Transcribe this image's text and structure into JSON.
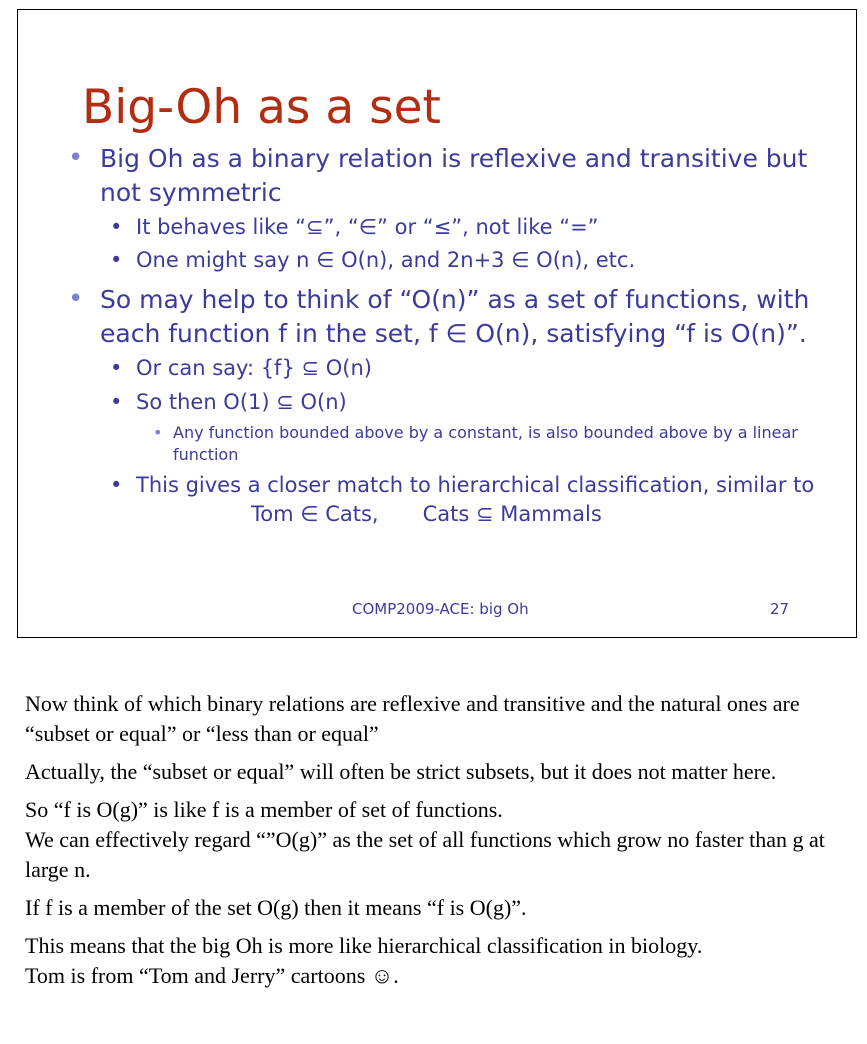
{
  "slide": {
    "title": "Big-Oh as a set",
    "bullets": [
      {
        "level": 1,
        "text": "Big Oh as a binary relation is reflexive and transitive but not symmetric"
      },
      {
        "level": 2,
        "text": "It behaves like “⊆”, “∈” or “≤”, not like “=”"
      },
      {
        "level": 2,
        "text": "One might say n ∈ O(n), and 2n+3 ∈ O(n), etc."
      },
      {
        "level": 1,
        "text": "So may help to think of “O(n)” as a set of functions, with each function f in the set, f ∈ O(n), satisfying “f is O(n)”."
      },
      {
        "level": 2,
        "text": "Or can say: {f} ⊆ O(n)"
      },
      {
        "level": 2,
        "text": "So then  O(1) ⊆ O(n)"
      },
      {
        "level": 3,
        "text": "Any function bounded above by a constant, is also bounded above by a linear function"
      },
      {
        "level": 2,
        "text": "This gives a closer match to hierarchical classification, similar to"
      }
    ],
    "example_left": "Tom ∈ Cats,",
    "example_right": "Cats ⊆ Mammals",
    "footer": {
      "course": "COMP2009-ACE: big Oh",
      "page_number": "27"
    }
  },
  "notes": {
    "p1": "Now think of which binary relations are reflexive and transitive and the natural ones are “subset or equal” or “less than or equal”",
    "p2": "Actually, the “subset or equal” will often be strict subsets, but it does not matter here.",
    "p3a": "So “f is O(g)” is like f is a member of  set of functions.",
    "p3b": "We can effectively regard “”O(g)” as the set of all functions which grow no faster than g at large n.",
    "p4": "If f is a member of the set O(g) then it means “f is O(g)”.",
    "p5a": "This means that the big Oh is more like hierarchical classification in biology.",
    "p5b": "Tom is from “Tom and Jerry” cartoons ☺."
  }
}
